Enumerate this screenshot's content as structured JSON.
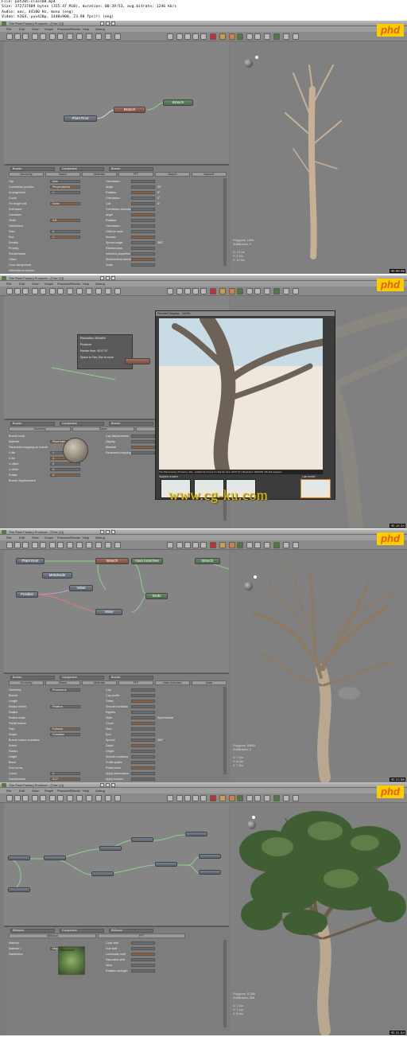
{
  "header": {
    "line1": "File: pot205-class08.mp4",
    "line2": "Size: 372737409 bytes (355.47 MiB), duration: 00:39:53, avg.bitrate: 1246 kb/s",
    "line3": "Audio: aac, 44100 Hz, mono (eng)",
    "line4": "Video: h264, yuv420p, 1440x900, 23.98 fps(r) (eng)"
  },
  "app": {
    "window_title": "The Plant Factory Producer - [Tree (1)]",
    "logo": "phd",
    "menu": [
      "File",
      "Edit",
      "View",
      "Graph",
      "Producer",
      "Render",
      "Help",
      "Debug"
    ],
    "accent": "#ffcc00"
  },
  "watermark": "www.cg-ku.com",
  "frames": [
    {
      "timestamp": "00:08:08",
      "nodes": {
        "n1": "Plant Root",
        "n2": "Branch",
        "n3": "Branch"
      },
      "combo": [
        "Branch",
        "Component",
        "Branch"
      ],
      "tabs": [
        "Geometry",
        "Bases",
        "Materials",
        "FFT",
        "Branch",
        "Branch2"
      ],
      "left_props": [
        "Clip",
        "Connection position",
        "Arrangement",
        "Count",
        "Fix length unit",
        "Drift insert",
        "Curvature",
        "Width",
        "Distribution",
        "Start",
        "End",
        "Density",
        "Pruning",
        "Randomness",
        "Offset",
        "Grow along insert",
        "Influential on branch"
      ],
      "left_vals": [
        "Axis",
        "Perpendicular",
        "1",
        "",
        "None",
        "",
        "",
        "0.8",
        "",
        "0",
        "1",
        "",
        "",
        "",
        "",
        "",
        ""
      ],
      "right_props": [
        "Orientation",
        "Angle",
        "Rotation",
        "Orientation",
        "Coil",
        "Orientation Inconsistencies",
        "Angle",
        "Rotation",
        "Orientation",
        "Orbit on node",
        "Number",
        "Spread angle",
        "Randomness",
        "Inherited properties",
        "Subbranches density",
        "Scale"
      ],
      "right_vals": [
        "",
        "30°",
        "0°",
        "0°",
        "0°",
        "",
        "",
        "",
        "",
        "",
        "",
        "360°",
        "",
        "",
        "",
        ""
      ],
      "stats": "Polygons: 1884\nSubBranch: 0\n\nX: 10.1m\nY: 2.9m\nZ: 10.9m"
    },
    {
      "timestamp": "00:16:04",
      "popup": [
        "Resolution: 600x600",
        "Producer",
        "Render time: 00:07:07",
        "Space to Pan, Esc to close"
      ],
      "render_title": "Render Display - 100%",
      "render_status": "The Plant Factory Producer | File - untitled.tpf | Frame 0 | Render time: 00:07:07 | Resolution: 600x600 | 35,424 polygons",
      "stacked_label": "Stacked renders",
      "last_label": "Last render",
      "combo": [
        "Branch",
        "Component",
        "Branch"
      ],
      "tabs": [
        "Geometry",
        "Bases",
        "Materials"
      ],
      "left_props": [
        "Branch body",
        "Material",
        "Parametric mapping on branch",
        "U tile",
        "V tile",
        "U offset",
        "V offset",
        "Rotate",
        "Branch displacement"
      ],
      "left_vals": [
        "",
        "Plant bark",
        "",
        "1",
        "1",
        "0",
        "0",
        "0",
        ""
      ],
      "right_props": [
        "Cap displacement",
        "Display",
        "Material",
        "Parametric mapping"
      ],
      "right_vals": [
        "",
        "",
        "Inherit from parent",
        ""
      ]
    },
    {
      "timestamp": "00:23:58",
      "nodes": {
        "n1": "Plant Root",
        "n2": "Branch",
        "n3": "main branches",
        "n4": "Branch",
        "n5": "MetaNode",
        "n6": "Position",
        "n7": "Value",
        "n8": "Value",
        "n9": "knots"
      },
      "combo": [
        "Branch",
        "Component",
        "Branch"
      ],
      "tabs": [
        "Geometry",
        "Bases",
        "Materials",
        "FFT",
        "main branches",
        "knots"
      ],
      "left_props": [
        "Geometry",
        "Branch",
        "Length",
        "Radius inherit",
        "Radius",
        "Radius scale",
        "Partial branch",
        "Path",
        "Shape",
        "Branch bottom transition",
        "Extent",
        "Radius",
        "Height",
        "Blend",
        "Knot forms",
        "Count",
        "Randomness"
      ],
      "left_vals": [
        "Procedural",
        "",
        "",
        "Relative",
        "",
        "",
        "",
        "Follower",
        "Guideline",
        "",
        "",
        "",
        "",
        "",
        "",
        "0",
        "0.17"
      ],
      "right_props": [
        "Cap",
        "Cap profile",
        "Offset",
        "Smooth transition",
        "Ripples",
        "Style",
        "Count",
        "Start",
        "End",
        "Spread",
        "Depth",
        "Height",
        "Smooth transition",
        "Profile plates",
        "Pedal mode",
        "Apply deformation",
        "Apply borders"
      ],
      "right_vals": [
        "",
        "",
        "",
        "",
        "",
        "Symmetrical",
        "",
        "",
        "",
        "360°",
        "",
        "",
        "",
        "",
        "",
        "",
        ""
      ],
      "stats": "Polygons: 50653\nSubBranch: 0\n\nX: 7.5m\nY: 8.3m\nZ: 7.5m"
    },
    {
      "timestamp": "00:31:54",
      "combo": [
        "Billboard",
        "Component",
        "Billboard"
      ],
      "tabs": [
        "Billboard",
        "FFT"
      ],
      "left_props": [
        "Material",
        "Material 1",
        "Distribution"
      ],
      "left_vals": [
        "",
        "Maple Branch TTK",
        ""
      ],
      "thumb_label": "Parametric",
      "right_props": [
        "Color shift",
        "Hue shift",
        "Luminosity shift",
        "Saturation shift",
        "Wind",
        "Rotation strength"
      ],
      "right_vals": [
        "",
        "",
        "",
        "",
        "",
        ""
      ],
      "stats": "Polygons: 57280\nSubBranch: 364\n\nX: 7.0m\nY: 7.2m\nZ: 5.0m"
    }
  ]
}
